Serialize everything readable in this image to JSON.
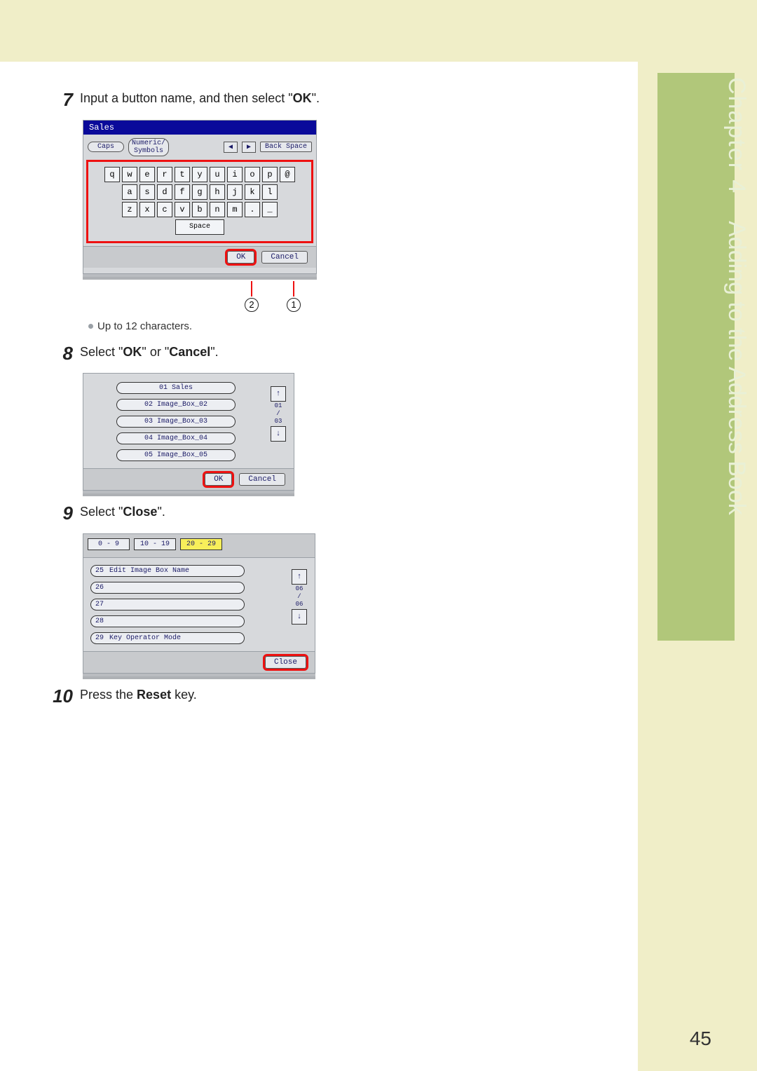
{
  "chapter": {
    "label": "Chapter 4",
    "title": "Adding to the Address Book"
  },
  "page_number": "45",
  "steps": {
    "s7": {
      "num": "7",
      "text_before": "Input a button name, and then select \"",
      "bold": "OK",
      "text_after": "\".",
      "note": "Up to 12 characters."
    },
    "s8": {
      "num": "8",
      "text_before": "Select \"",
      "bold1": "OK",
      "mid": "\" or \"",
      "bold2": "Cancel",
      "text_after": "\"."
    },
    "s9": {
      "num": "9",
      "text_before": "Select \"",
      "bold": "Close",
      "text_after": "\"."
    },
    "s10": {
      "num": "10",
      "text_before": "Press the ",
      "bold": "Reset",
      "text_after": " key."
    }
  },
  "callouts": {
    "one": "1",
    "two": "2"
  },
  "kbd": {
    "title": "Sales",
    "caps": "Caps",
    "numeric": "Numeric/\nSymbols",
    "back": "Back Space",
    "left": "◀",
    "right": "▶",
    "row1": [
      "q",
      "w",
      "e",
      "r",
      "t",
      "y",
      "u",
      "i",
      "o",
      "p",
      "@"
    ],
    "row2": [
      "a",
      "s",
      "d",
      "f",
      "g",
      "h",
      "j",
      "k",
      "l"
    ],
    "row3": [
      "z",
      "x",
      "c",
      "v",
      "b",
      "n",
      "m",
      ".",
      "_"
    ],
    "space": "Space",
    "ok": "OK",
    "cancel": "Cancel"
  },
  "list8": {
    "items": [
      "01 Sales",
      "02 Image_Box_02",
      "03 Image_Box_03",
      "04 Image_Box_04",
      "05 Image_Box_05"
    ],
    "scroll_top": "01",
    "scroll_mid": "/",
    "scroll_bot": "03",
    "up": "↑",
    "down": "↓",
    "ok": "OK",
    "cancel": "Cancel"
  },
  "tabs9": {
    "tabs": [
      "0  -  9",
      "10 - 19",
      "20 - 29"
    ],
    "rows": [
      {
        "n": "25",
        "label": "Edit Image Box Name"
      },
      {
        "n": "26",
        "label": ""
      },
      {
        "n": "27",
        "label": ""
      },
      {
        "n": "28",
        "label": ""
      },
      {
        "n": "29",
        "label": "Key Operator Mode"
      }
    ],
    "scroll_top": "06",
    "scroll_mid": "/",
    "scroll_bot": "06",
    "up": "↑",
    "down": "↓",
    "close": "Close"
  }
}
